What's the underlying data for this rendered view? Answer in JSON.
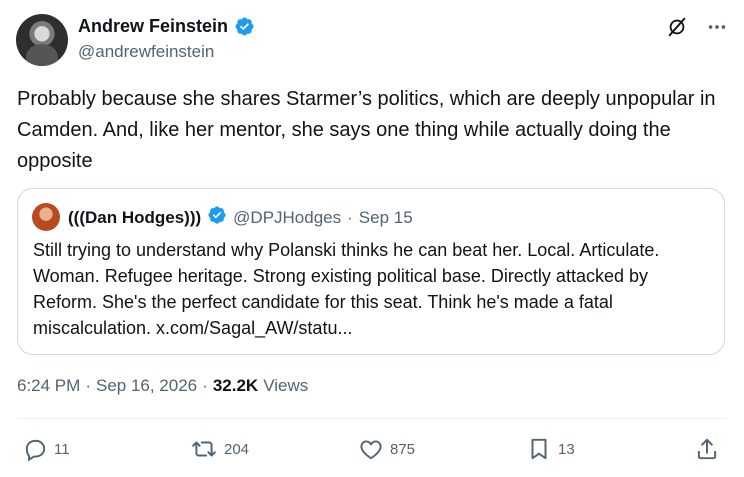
{
  "author": {
    "name": "Andrew Feinstein",
    "handle": "@andrewfeinstein"
  },
  "tweet_text": "Probably because she shares Starmer’s politics, which are deeply unpopular in Camden. And, like her mentor, she says one thing while actually doing the opposite",
  "quoted": {
    "name": "(((Dan Hodges)))",
    "handle": "@DPJHodges",
    "separator": "·",
    "date": "Sep 15",
    "text": "Still trying to understand why Polanski thinks he can beat her. Local. Articulate. Woman. Refugee heritage. Strong existing political base. Directly attacked by Reform. She's the perfect candidate for this seat. Think he's made a fatal miscalculation. x.com/Sagal_AW/statu..."
  },
  "meta": {
    "time": "6:24 PM",
    "sep1": "·",
    "date": "Sep 16, 2026",
    "sep2": "·",
    "views_count": "32.2K",
    "views_label": "Views"
  },
  "actions": {
    "replies": "11",
    "reposts": "204",
    "likes": "875",
    "bookmarks": "13"
  },
  "colors": {
    "verified": "#1d9bf0",
    "secondary_text": "#536471",
    "border": "#cfd9de"
  },
  "icons": [
    "verified-badge-icon",
    "grok-icon",
    "more-icon",
    "reply-icon",
    "repost-icon",
    "like-icon",
    "bookmark-icon",
    "share-icon"
  ]
}
